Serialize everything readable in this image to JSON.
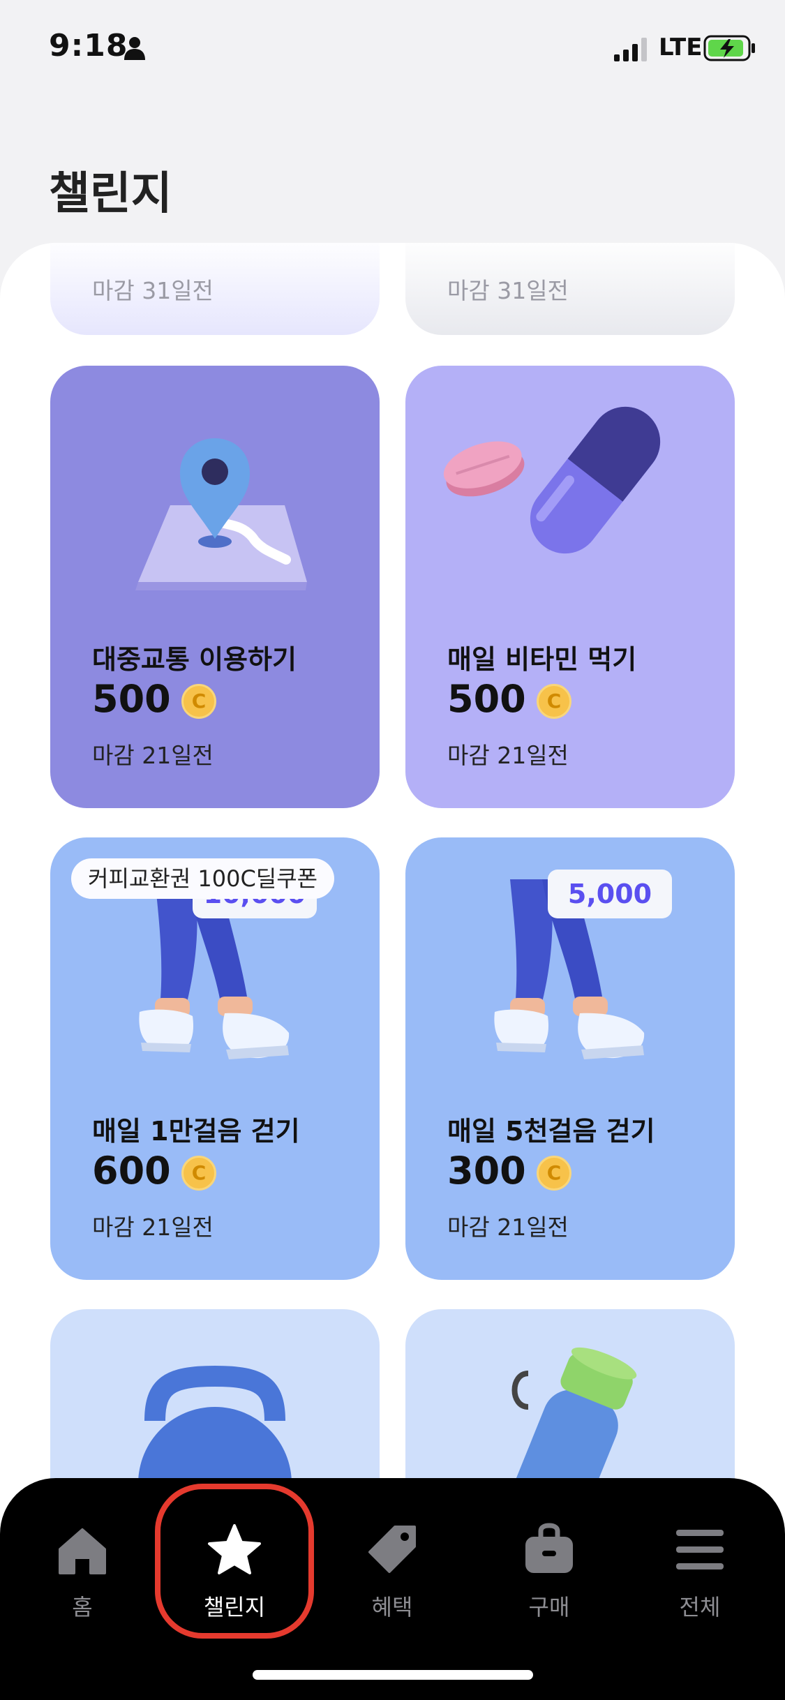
{
  "status_bar": {
    "time": "9:18",
    "network": "LTE"
  },
  "page": {
    "title": "챌린지"
  },
  "top_cards": [
    {
      "deadline": "마감 31일전"
    },
    {
      "deadline": "마감 31일전"
    }
  ],
  "cards": [
    {
      "title": "대중교통 이용하기",
      "points": "500",
      "coin": "C",
      "deadline": "마감 21일전",
      "illustration": "map-pin-illustration",
      "bg": "#8d8ae0"
    },
    {
      "title": "매일 비타민 먹기",
      "points": "500",
      "coin": "C",
      "deadline": "마감 21일전",
      "illustration": "pills-illustration",
      "bg": "#b4b0f7"
    },
    {
      "title": "매일 1만걸음 걷기",
      "points": "600",
      "coin": "C",
      "deadline": "마감 21일전",
      "illustration": "walking-legs-illustration",
      "bubble": "10,000",
      "badge": "커피교환권 100C딜쿠폰",
      "bg": "#99bbf7"
    },
    {
      "title": "매일 5천걸음 걷기",
      "points": "300",
      "coin": "C",
      "deadline": "마감 21일전",
      "illustration": "walking-legs-illustration",
      "bubble": "5,000",
      "bg": "#99bbf7"
    }
  ],
  "partial_cards": [
    {
      "illustration": "kettlebell-illustration",
      "bg": "#cfdffb"
    },
    {
      "illustration": "water-bottle-illustration",
      "bg": "#cfdffb"
    }
  ],
  "tab_bar": {
    "active": "챌린지",
    "tabs": [
      {
        "label": "홈",
        "icon": "home-icon"
      },
      {
        "label": "챌린지",
        "icon": "star-icon"
      },
      {
        "label": "혜택",
        "icon": "tag-icon"
      },
      {
        "label": "구매",
        "icon": "bag-icon"
      },
      {
        "label": "전체",
        "icon": "menu-icon"
      }
    ]
  },
  "colors": {
    "active_highlight": "#e53a2e",
    "tab_bar_bg": "#000000",
    "coin": "#f7c24a"
  }
}
